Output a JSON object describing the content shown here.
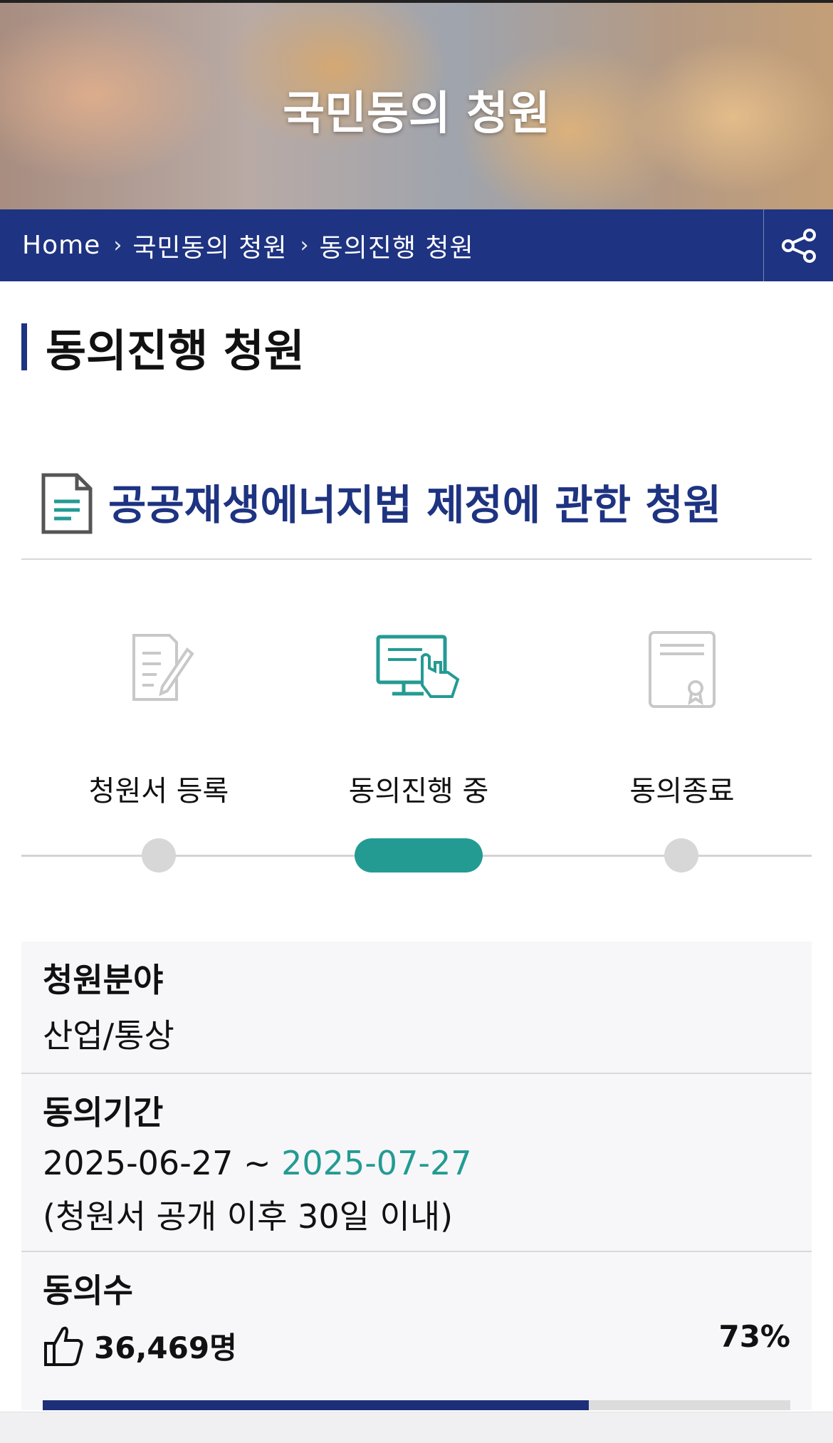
{
  "hero": {
    "title": "국민동의 청원"
  },
  "breadcrumb": {
    "items": [
      "Home",
      "국민동의 청원",
      "동의진행 청원"
    ],
    "separator": ">"
  },
  "share_icon": "share-icon",
  "page": {
    "title": "동의진행 청원"
  },
  "petition": {
    "title": "공공재생에너지법 제정에 관한 청원",
    "icon": "document-icon"
  },
  "steps": [
    {
      "label": "청원서 등록",
      "icon": "pen-document-icon",
      "state": "done"
    },
    {
      "label": "동의진행 중",
      "icon": "monitor-hand-icon",
      "state": "active"
    },
    {
      "label": "동의종료",
      "icon": "certificate-icon",
      "state": "pending"
    }
  ],
  "info": {
    "field": {
      "label": "청원분야",
      "value": "산업/통상"
    },
    "period": {
      "label": "동의기간",
      "start": "2025-06-27",
      "separator": "~",
      "end": "2025-07-27",
      "note": "(청원서 공개 이후 30일 이내)"
    },
    "agree": {
      "label": "동의수",
      "count": "36,469명",
      "percent": "73%",
      "progress": 0.73,
      "icon": "thumbs-up-icon"
    }
  },
  "colors": {
    "navy": "#1e3381",
    "teal": "#239b93",
    "gray": "#d7d7d7"
  }
}
